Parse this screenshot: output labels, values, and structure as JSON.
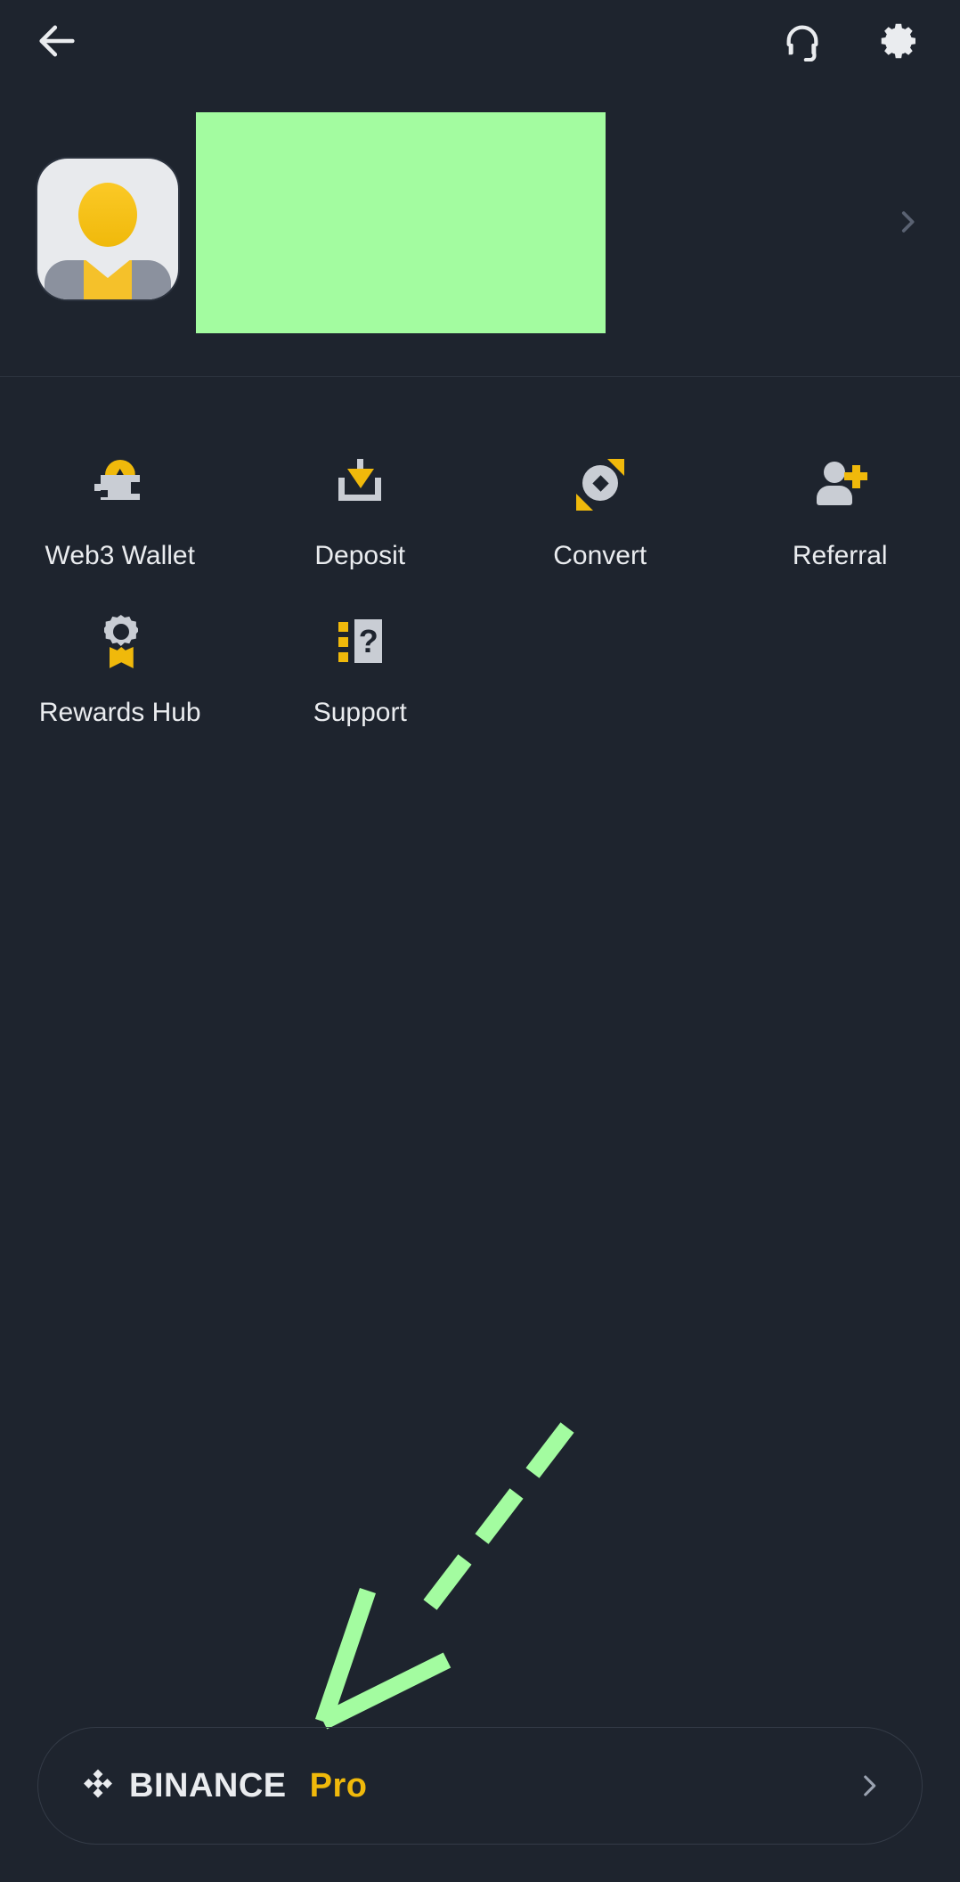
{
  "theme": {
    "background": "#1e242e",
    "accent_yellow": "#f0b90b",
    "text_primary": "#eaecef",
    "icon_gray": "#c9cdd4",
    "annotation_green": "#a3fca0",
    "divider": "#2b323d"
  },
  "header": {
    "back_icon": "arrow-left-icon",
    "support_icon": "headset-icon",
    "settings_icon": "gear-icon"
  },
  "profile": {
    "avatar_icon": "user-avatar-icon",
    "redacted_name_block": "",
    "chevron_icon": "chevron-right-icon"
  },
  "shortcuts": [
    {
      "label": "Web3 Wallet",
      "icon": "web3-wallet-icon"
    },
    {
      "label": "Deposit",
      "icon": "deposit-icon"
    },
    {
      "label": "Convert",
      "icon": "convert-icon"
    },
    {
      "label": "Referral",
      "icon": "referral-add-user-icon"
    },
    {
      "label": "Rewards Hub",
      "icon": "rewards-badge-icon"
    },
    {
      "label": "Support",
      "icon": "support-question-icon"
    }
  ],
  "annotation": {
    "type": "dashed-arrow",
    "color": "#a3fca0",
    "direction": "down-left",
    "points_to": "binance-pro-bar"
  },
  "pro_bar": {
    "logo_icon": "binance-diamond-logo",
    "brand": "BINANCE",
    "suffix": "Pro",
    "chevron_icon": "chevron-right-icon"
  }
}
